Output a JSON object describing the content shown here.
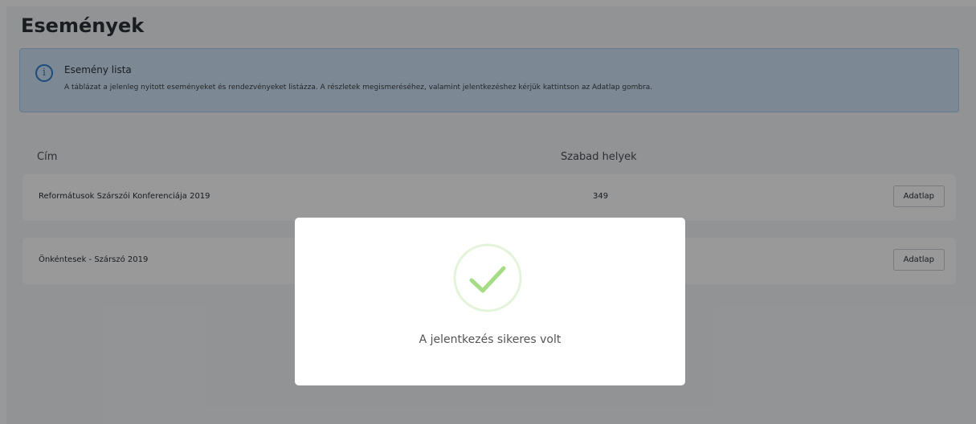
{
  "page": {
    "title": "Események"
  },
  "info": {
    "icon": "info-circle-icon",
    "title": "Esemény lista",
    "text": "A táblázat a jelenleg nyitott eseményeket és rendezvényeket listázza. A részletek megismeréséhez, valamint jelentkezéshez kérjük kattintson az Adatlap gombra."
  },
  "table": {
    "headers": [
      "Cím",
      "Szabad helyek"
    ],
    "rows": [
      {
        "title": "Reformátusok Szárszói Konferenciája 2019",
        "seats": "349",
        "button": "Adatlap"
      },
      {
        "title": "Önkéntesek - Szárszó 2019",
        "seats": "",
        "button": "Adatlap"
      }
    ]
  },
  "modal": {
    "icon": "success-check-icon",
    "message": "A jelentkezés sikeres volt"
  },
  "colors": {
    "success": "#a5dc86",
    "info_bg": "#cfe4f7",
    "info_accent": "#2f7fd0"
  }
}
